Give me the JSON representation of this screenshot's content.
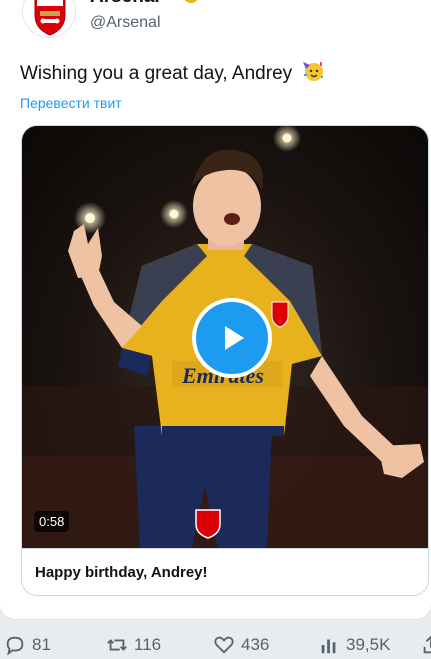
{
  "tweet": {
    "display_name": "Arsenal",
    "handle": "@Arsenal",
    "text": "Wishing you a great day, Andrey",
    "emoji": "partying-face",
    "translate_label": "Перевести твит",
    "media": {
      "duration": "0:58",
      "caption": "Happy birthday, Andrey!",
      "sponsor_text": "Emirates"
    },
    "stats": {
      "replies": "81",
      "retweets": "116",
      "likes": "436",
      "views": "39,5K"
    }
  },
  "colors": {
    "accent": "#1d9bf0",
    "text_primary": "#0f1419",
    "text_secondary": "#536471",
    "club_red": "#db0007",
    "away_yellow": "#e8b21e",
    "away_navy": "#1b2a5b"
  },
  "icons": [
    "arsenal-crest-icon",
    "verified-badge-icon",
    "partying-face-icon",
    "play-icon",
    "reply-icon",
    "retweet-icon",
    "like-icon",
    "views-icon",
    "share-icon"
  ]
}
